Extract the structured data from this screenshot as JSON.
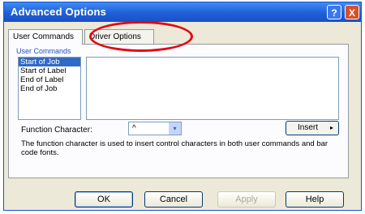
{
  "window": {
    "title": "Advanced Options",
    "help_glyph": "?",
    "close_glyph": "X"
  },
  "tabs": [
    {
      "label": "User Commands",
      "selected": true
    },
    {
      "label": "Driver Options",
      "selected": false
    }
  ],
  "user_commands": {
    "group_label": "User Commands",
    "items": [
      "Start of Job",
      "Start of Label",
      "End of Label",
      "End of Job"
    ],
    "selected_index": 0
  },
  "function_character": {
    "label": "Function Character:",
    "value": "^",
    "arrow_glyph": "▾"
  },
  "insert_button": {
    "label": "Insert",
    "arrow_glyph": "▸"
  },
  "description": "The function character is used to insert control characters in both user commands and bar code fonts.",
  "buttons": {
    "ok": "OK",
    "cancel": "Cancel",
    "apply": "Apply",
    "help": "Help"
  },
  "colors": {
    "title_bar": "#1f5fd8",
    "annotation": "#e30613",
    "selection": "#316ac5"
  }
}
